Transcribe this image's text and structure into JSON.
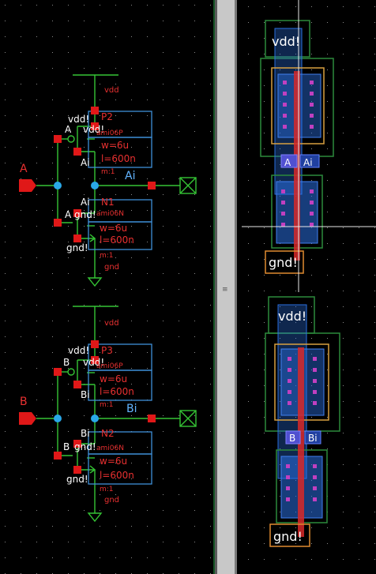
{
  "colors": {
    "background": "#000000",
    "wire": "#35c435",
    "pin": "#e01818",
    "net_dot": "#2aa8e8",
    "symbol_box": "#3f8fd8",
    "text_white": "#ffffff",
    "text_red": "#e83030",
    "text_blue": "#62b4ff",
    "divider": "#c8c8c8",
    "nwell": "#2c8a3c",
    "diffusion": "#2a6fe0",
    "poly": "#d82828",
    "metal": "#e08a30",
    "contact": "#c040c0"
  },
  "schematic": {
    "cell1": {
      "vdd": "vdd",
      "pmos_name": "P2",
      "pmos_bulk": "vdd!",
      "pmos_model": "ami06P",
      "pmos_w": "w=6u",
      "pmos_l": "l=600n",
      "pmos_m": "m:1",
      "pmos_gate": "A",
      "pmos_drain": "Ai",
      "input_pin": "A",
      "output_net": "Ai",
      "nmos_name": "N1",
      "nmos_drain": "Ai",
      "nmos_gate": "A",
      "nmos_bulk": "gnd!",
      "nmos_model": "ami06N",
      "nmos_w": "w=6u",
      "nmos_l": "l=600n",
      "nmos_m": "m:1",
      "nmos_source": "gnd!",
      "gnd": "gnd"
    },
    "cell2": {
      "vdd": "vdd",
      "pmos_name": "P3",
      "pmos_bulk": "vdd!",
      "pmos_model": "ami06P",
      "pmos_w": "w=6u",
      "pmos_l": "l=600n",
      "pmos_m": "m:1",
      "pmos_gate": "B",
      "pmos_drain": "Bi",
      "input_pin": "B",
      "output_net": "Bi",
      "nmos_name": "N2",
      "nmos_drain": "Bi",
      "nmos_gate": "B",
      "nmos_bulk": "gnd!",
      "nmos_model": "ami06N",
      "nmos_w": "w=6u",
      "nmos_l": "l=600n",
      "nmos_m": "m:1",
      "nmos_source": "gnd!",
      "gnd": "gnd"
    }
  },
  "layout": {
    "cell1": {
      "vdd": "vdd!",
      "in": "A",
      "out": "Ai",
      "gnd": "gnd!"
    },
    "cell2": {
      "vdd": "vdd!",
      "in": "B",
      "out": "Bi",
      "gnd": "gnd!"
    }
  },
  "divider_grip": "≡"
}
